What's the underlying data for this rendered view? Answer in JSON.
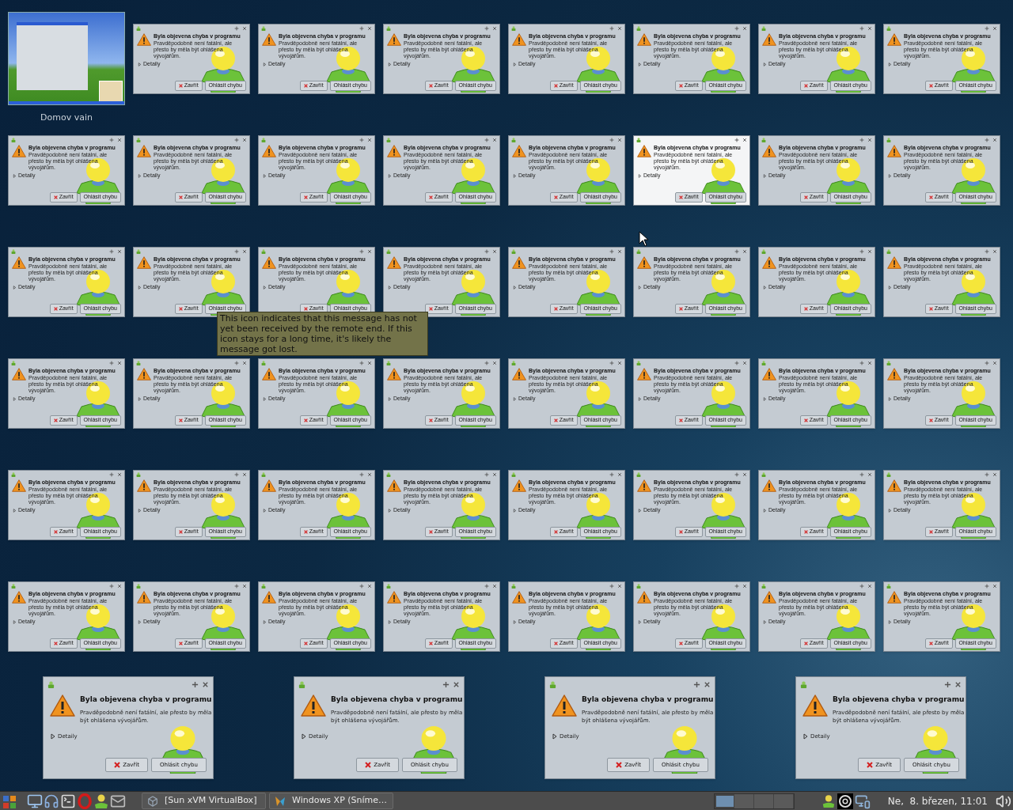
{
  "desktop": {
    "icon_label": "Domov vain"
  },
  "dialogs": [
    {
      "title": "Byla objevena chyba v programu",
      "message": "Pravděpodobně není fatální, ale přesto by měla být ohlášena vývojářům.",
      "details": "Detaily",
      "close": "Zavřít",
      "report": "Ohlásit chybu",
      "selected": false
    },
    {
      "title": "Byla objevena chyba v programu",
      "message": "Pravděpodobně není fatální, ale přesto by měla být ohlášena vývojářům.",
      "details": "Detaily",
      "close": "Zavřít",
      "report": "Ohlásit chybu",
      "selected": false
    },
    {
      "title": "Byla objevena chyba v programu",
      "message": "Pravděpodobně není fatální, ale přesto by měla být ohlášena vývojářům.",
      "details": "Detaily",
      "close": "Zavřít",
      "report": "Ohlásit chybu",
      "selected": false
    },
    {
      "title": "Byla objevena chyba v programu",
      "message": "Pravděpodobně není fatální, ale přesto by měla být ohlášena vývojářům.",
      "details": "Detaily",
      "close": "Zavřít",
      "report": "Ohlásit chybu",
      "selected": false
    },
    {
      "title": "Byla objevena chyba v programu",
      "message": "Pravděpodobně není fatální, ale přesto by měla být ohlášena vývojářům.",
      "details": "Detaily",
      "close": "Zavřít",
      "report": "Ohlásit chybu",
      "selected": false
    },
    {
      "title": "Byla objevena chyba v programu",
      "message": "Pravděpodobně není fatální, ale přesto by měla být ohlášena vývojářům.",
      "details": "Detaily",
      "close": "Zavřít",
      "report": "Ohlásit chybu",
      "selected": false
    },
    {
      "title": "Byla objevena chyba v programu",
      "message": "Pravděpodobně není fatální, ale přesto by měla být ohlášena vývojářům.",
      "details": "Detaily",
      "close": "Zavřít",
      "report": "Ohlásit chybu",
      "selected": false
    },
    {
      "title": "Byla objevena chyba v programu",
      "message": "Pravděpodobně není fatální, ale přesto by měla být ohlášena vývojářům.",
      "details": "Detaily",
      "close": "Zavřít",
      "report": "Ohlásit chybu",
      "selected": false
    },
    {
      "title": "Byla objevena chyba v programu",
      "message": "Pravděpodobně není fatální, ale přesto by měla být ohlášena vývojářům.",
      "details": "Detaily",
      "close": "Zavřít",
      "report": "Ohlásit chybu",
      "selected": false
    },
    {
      "title": "Byla objevena chyba v programu",
      "message": "Pravděpodobně není fatální, ale přesto by měla být ohlášena vývojářům.",
      "details": "Detaily",
      "close": "Zavřít",
      "report": "Ohlásit chybu",
      "selected": false
    },
    {
      "title": "Byla objevena chyba v programu",
      "message": "Pravděpodobně není fatální, ale přesto by měla být ohlášena vývojářům.",
      "details": "Detaily",
      "close": "Zavřít",
      "report": "Ohlásit chybu",
      "selected": false
    },
    {
      "title": "Byla objevena chyba v programu",
      "message": "Pravděpodobně není fatální, ale přesto by měla být ohlášena vývojářům.",
      "details": "Detaily",
      "close": "Zavřít",
      "report": "Ohlásit chybu",
      "selected": false
    },
    {
      "title": "Byla objevena chyba v programu",
      "message": "Pravděpodobně není fatální, ale přesto by měla být ohlášena vývojářům.",
      "details": "Detaily",
      "close": "Zavřít",
      "report": "Ohlásit chybu",
      "selected": true
    },
    {
      "title": "Byla objevena chyba v programu",
      "message": "Pravděpodobně není fatální, ale přesto by měla být ohlášena vývojářům.",
      "details": "Detaily",
      "close": "Zavřít",
      "report": "Ohlásit chybu",
      "selected": false
    },
    {
      "title": "Byla objevena chyba v programu",
      "message": "Pravděpodobně není fatální, ale přesto by měla být ohlášena vývojářům.",
      "details": "Detaily",
      "close": "Zavřít",
      "report": "Ohlásit chybu",
      "selected": false
    },
    {
      "title": "Byla objevena chyba v programu",
      "message": "Pravděpodobně není fatální, ale přesto by měla být ohlášena vývojářům.",
      "details": "Detaily",
      "close": "Zavřít",
      "report": "Ohlásit chybu",
      "selected": false
    },
    {
      "title": "Byla objevena chyba v programu",
      "message": "Pravděpodobně není fatální, ale přesto by měla být ohlášena vývojářům.",
      "details": "Detaily",
      "close": "Zavřít",
      "report": "Ohlásit chybu",
      "selected": false
    },
    {
      "title": "Byla objevena chyba v programu",
      "message": "Pravděpodobně není fatální, ale přesto by měla být ohlášena vývojářům.",
      "details": "Detaily",
      "close": "Zavřít",
      "report": "Ohlásit chybu",
      "selected": false
    },
    {
      "title": "Byla objevena chyba v programu",
      "message": "Pravděpodobně není fatální, ale přesto by měla být ohlášena vývojářům.",
      "details": "Detaily",
      "close": "Zavřít",
      "report": "Ohlásit chybu",
      "selected": false
    },
    {
      "title": "Byla objevena chyba v programu",
      "message": "Pravděpodobně není fatální, ale přesto by měla být ohlášena vývojářům.",
      "details": "Detaily",
      "close": "Zavřít",
      "report": "Ohlásit chybu",
      "selected": false
    },
    {
      "title": "Byla objevena chyba v programu",
      "message": "Pravděpodobně není fatální, ale přesto by měla být ohlášena vývojářům.",
      "details": "Detaily",
      "close": "Zavřít",
      "report": "Ohlásit chybu",
      "selected": false
    },
    {
      "title": "Byla objevena chyba v programu",
      "message": "Pravděpodobně není fatální, ale přesto by měla být ohlášena vývojářům.",
      "details": "Detaily",
      "close": "Zavřít",
      "report": "Ohlásit chybu",
      "selected": false
    },
    {
      "title": "Byla objevena chyba v programu",
      "message": "Pravděpodobně není fatální, ale přesto by měla být ohlášena vývojářům.",
      "details": "Detaily",
      "close": "Zavřít",
      "report": "Ohlásit chybu",
      "selected": false
    },
    {
      "title": "Byla objevena chyba v programu",
      "message": "Pravděpodobně není fatální, ale přesto by měla být ohlášena vývojářům.",
      "details": "Detaily",
      "close": "Zavřít",
      "report": "Ohlásit chybu",
      "selected": false
    },
    {
      "title": "Byla objevena chyba v programu",
      "message": "Pravděpodobně není fatální, ale přesto by měla být ohlášena vývojářům.",
      "details": "Detaily",
      "close": "Zavřít",
      "report": "Ohlásit chybu",
      "selected": false
    },
    {
      "title": "Byla objevena chyba v programu",
      "message": "Pravděpodobně není fatální, ale přesto by měla být ohlášena vývojářům.",
      "details": "Detaily",
      "close": "Zavřít",
      "report": "Ohlásit chybu",
      "selected": false
    },
    {
      "title": "Byla objevena chyba v programu",
      "message": "Pravděpodobně není fatální, ale přesto by měla být ohlášena vývojářům.",
      "details": "Detaily",
      "close": "Zavřít",
      "report": "Ohlásit chybu",
      "selected": false
    },
    {
      "title": "Byla objevena chyba v programu",
      "message": "Pravděpodobně není fatální, ale přesto by měla být ohlášena vývojářům.",
      "details": "Detaily",
      "close": "Zavřít",
      "report": "Ohlásit chybu",
      "selected": false
    },
    {
      "title": "Byla objevena chyba v programu",
      "message": "Pravděpodobně není fatální, ale přesto by měla být ohlášena vývojářům.",
      "details": "Detaily",
      "close": "Zavřít",
      "report": "Ohlásit chybu",
      "selected": false
    },
    {
      "title": "Byla objevena chyba v programu",
      "message": "Pravděpodobně není fatální, ale přesto by měla být ohlášena vývojářům.",
      "details": "Detaily",
      "close": "Zavřít",
      "report": "Ohlásit chybu",
      "selected": false
    },
    {
      "title": "Byla objevena chyba v programu",
      "message": "Pravděpodobně není fatální, ale přesto by měla být ohlášena vývojářům.",
      "details": "Detaily",
      "close": "Zavřít",
      "report": "Ohlásit chybu",
      "selected": false
    },
    {
      "title": "Byla objevena chyba v programu",
      "message": "Pravděpodobně není fatální, ale přesto by měla být ohlášena vývojářům.",
      "details": "Detaily",
      "close": "Zavřít",
      "report": "Ohlásit chybu",
      "selected": false
    },
    {
      "title": "Byla objevena chyba v programu",
      "message": "Pravděpodobně není fatální, ale přesto by měla být ohlášena vývojářům.",
      "details": "Detaily",
      "close": "Zavřít",
      "report": "Ohlásit chybu",
      "selected": false
    },
    {
      "title": "Byla objevena chyba v programu",
      "message": "Pravděpodobně není fatální, ale přesto by měla být ohlášena vývojářům.",
      "details": "Detaily",
      "close": "Zavřít",
      "report": "Ohlásit chybu",
      "selected": false
    },
    {
      "title": "Byla objevena chyba v programu",
      "message": "Pravděpodobně není fatální, ale přesto by měla být ohlášena vývojářům.",
      "details": "Detaily",
      "close": "Zavřít",
      "report": "Ohlásit chybu",
      "selected": false
    },
    {
      "title": "Byla objevena chyba v programu",
      "message": "Pravděpodobně není fatální, ale přesto by měla být ohlášena vývojářům.",
      "details": "Detaily",
      "close": "Zavřít",
      "report": "Ohlásit chybu",
      "selected": false
    },
    {
      "title": "Byla objevena chyba v programu",
      "message": "Pravděpodobně není fatální, ale přesto by měla být ohlášena vývojářům.",
      "details": "Detaily",
      "close": "Zavřít",
      "report": "Ohlásit chybu",
      "selected": false
    },
    {
      "title": "Byla objevena chyba v programu",
      "message": "Pravděpodobně není fatální, ale přesto by měla být ohlášena vývojářům.",
      "details": "Detaily",
      "close": "Zavřít",
      "report": "Ohlásit chybu",
      "selected": false
    },
    {
      "title": "Byla objevena chyba v programu",
      "message": "Pravděpodobně není fatální, ale přesto by měla být ohlášena vývojářům.",
      "details": "Detaily",
      "close": "Zavřít",
      "report": "Ohlásit chybu",
      "selected": false
    },
    {
      "title": "Byla objevena chyba v programu",
      "message": "Pravděpodobně není fatální, ale přesto by měla být ohlášena vývojářům.",
      "details": "Detaily",
      "close": "Zavřít",
      "report": "Ohlásit chybu",
      "selected": false
    },
    {
      "title": "Byla objevena chyba v programu",
      "message": "Pravděpodobně není fatální, ale přesto by měla být ohlášena vývojářům.",
      "details": "Detaily",
      "close": "Zavřít",
      "report": "Ohlásit chybu",
      "selected": false
    },
    {
      "title": "Byla objevena chyba v programu",
      "message": "Pravděpodobně není fatální, ale přesto by měla být ohlášena vývojářům.",
      "details": "Detaily",
      "close": "Zavřít",
      "report": "Ohlásit chybu",
      "selected": false
    },
    {
      "title": "Byla objevena chyba v programu",
      "message": "Pravděpodobně není fatální, ale přesto by měla být ohlášena vývojářům.",
      "details": "Detaily",
      "close": "Zavřít",
      "report": "Ohlásit chybu",
      "selected": false
    },
    {
      "title": "Byla objevena chyba v programu",
      "message": "Pravděpodobně není fatální, ale přesto by měla být ohlášena vývojářům.",
      "details": "Detaily",
      "close": "Zavřít",
      "report": "Ohlásit chybu",
      "selected": false
    },
    {
      "title": "Byla objevena chyba v programu",
      "message": "Pravděpodobně není fatální, ale přesto by měla být ohlášena vývojářům.",
      "details": "Detaily",
      "close": "Zavřít",
      "report": "Ohlásit chybu",
      "selected": false
    },
    {
      "title": "Byla objevena chyba v programu",
      "message": "Pravděpodobně není fatální, ale přesto by měla být ohlášena vývojářům.",
      "details": "Detaily",
      "close": "Zavřít",
      "report": "Ohlásit chybu",
      "selected": false
    },
    {
      "title": "Byla objevena chyba v programu",
      "message": "Pravděpodobně není fatální, ale přesto by měla být ohlášena vývojářům.",
      "details": "Detaily",
      "close": "Zavřít",
      "report": "Ohlásit chybu",
      "selected": false
    }
  ],
  "large_dialogs": [
    {
      "title": "Byla objevena chyba v programu",
      "message": "Pravděpodobně není fatální, ale přesto by měla být ohlášena vývojářům.",
      "details": "Detaily",
      "close": "Zavřít",
      "report": "Ohlásit chybu",
      "selected": false
    },
    {
      "title": "Byla objevena chyba v programu",
      "message": "Pravděpodobně není fatální, ale přesto by měla být ohlášena vývojářům.",
      "details": "Detaily",
      "close": "Zavřít",
      "report": "Ohlásit chybu",
      "selected": false
    },
    {
      "title": "Byla objevena chyba v programu",
      "message": "Pravděpodobně není fatální, ale přesto by měla být ohlášena vývojářům.",
      "details": "Detaily",
      "close": "Zavřít",
      "report": "Ohlásit chybu",
      "selected": false
    },
    {
      "title": "Byla objevena chyba v programu",
      "message": "Pravděpodobně není fatální, ale přesto by měla být ohlášena vývojářům.",
      "details": "Detaily",
      "close": "Zavřít",
      "report": "Ohlásit chybu",
      "selected": false
    }
  ],
  "tooltip": "This icon indicates that this message has not yet been received by the remote end. If this icon stays for a long time, it's likely the message got lost.",
  "taskbar": {
    "tasks": [
      {
        "label": "[Sun xVM VirtualBox]",
        "kind": "virtualbox"
      },
      {
        "label": "Windows XP (Sníme…",
        "kind": "xp"
      }
    ],
    "pager": [
      {
        "selected": true
      },
      {
        "selected": false
      },
      {
        "selected": false
      },
      {
        "selected": false
      }
    ],
    "clock": "Ne,  8. březen, 11:01"
  }
}
